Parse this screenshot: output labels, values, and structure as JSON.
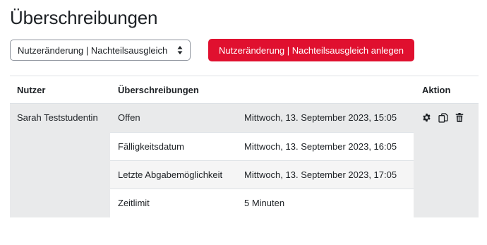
{
  "page": {
    "title": "Überschreibungen"
  },
  "controls": {
    "select_value": "Nutzeränderung | Nachteilsausgleich",
    "add_button_label": "Nutzeränderung | Nachteilsausgleich anlegen"
  },
  "table": {
    "headers": {
      "user": "Nutzer",
      "overrides": "Überschreibungen",
      "action": "Aktion"
    },
    "rows": [
      {
        "user": "Sarah Teststudentin",
        "overrides": [
          {
            "label": "Offen",
            "value": "Mittwoch, 13. September 2023, 15:05"
          },
          {
            "label": "Fälligkeitsdatum",
            "value": "Mittwoch, 13. September 2023, 16:05"
          },
          {
            "label": "Letzte Abgabemöglichkeit",
            "value": "Mittwoch, 13. September 2023, 17:05"
          },
          {
            "label": "Zeitlimit",
            "value": "5 Minuten"
          }
        ],
        "actions": [
          "gear-icon",
          "copy-icon",
          "trash-icon"
        ]
      }
    ]
  },
  "colors": {
    "primary": "#e0102f",
    "row_bg": "#e9eaeb",
    "text": "#1d2125"
  }
}
